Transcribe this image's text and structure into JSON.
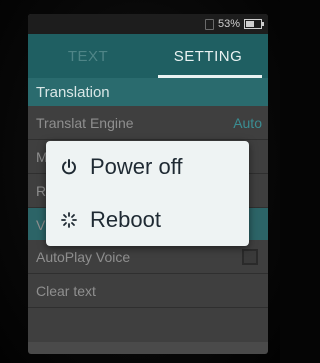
{
  "status_bar": {
    "battery_percent": "53%"
  },
  "tabs": [
    {
      "label": "TEXT",
      "active": false
    },
    {
      "label": "SETTING",
      "active": true
    }
  ],
  "section": {
    "title": "Translation"
  },
  "settings": [
    {
      "label": "Translat Engine",
      "value": "Auto"
    },
    {
      "label": "M",
      "value": ""
    },
    {
      "label": "R",
      "value": ""
    },
    {
      "label": "V",
      "value": ""
    },
    {
      "label": "AutoPlay Voice",
      "checked": false
    },
    {
      "label": "Clear text"
    }
  ],
  "power_menu": {
    "power_off": {
      "label": "Power off",
      "icon": "power-icon"
    },
    "reboot": {
      "label": "Reboot",
      "icon": "reboot-icon"
    }
  },
  "colors": {
    "tab_bar": "#1f5f62",
    "accent": "#3a8d92",
    "dialog_bg": "#eef3f3"
  }
}
